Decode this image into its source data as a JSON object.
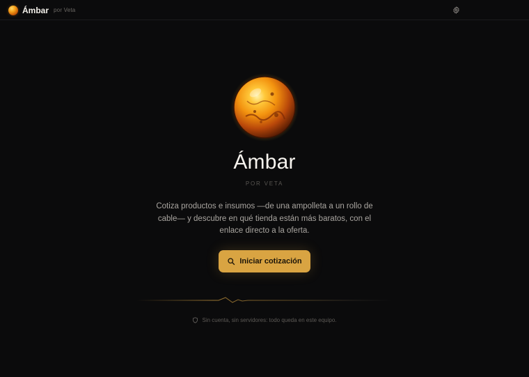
{
  "header": {
    "brand_name": "Ámbar",
    "brand_sub": "por Veta",
    "settings_icon": "gear-icon"
  },
  "hero": {
    "title": "Ámbar",
    "subtitle": "POR VETA",
    "description": "Cotiza productos e insumos —de una ampolleta a un rollo de cable— y descubre en qué tienda están más baratos, con el enlace directo a la oferta.",
    "cta_label": "Iniciar cotización",
    "cta_icon": "search-icon"
  },
  "footer": {
    "note": "Sin cuenta, sin servidores: todo queda en este equipo.",
    "note_icon": "shield-icon"
  },
  "colors": {
    "background": "#0b0b0c",
    "accent": "#d9a442",
    "amber": "#f5a21a"
  }
}
